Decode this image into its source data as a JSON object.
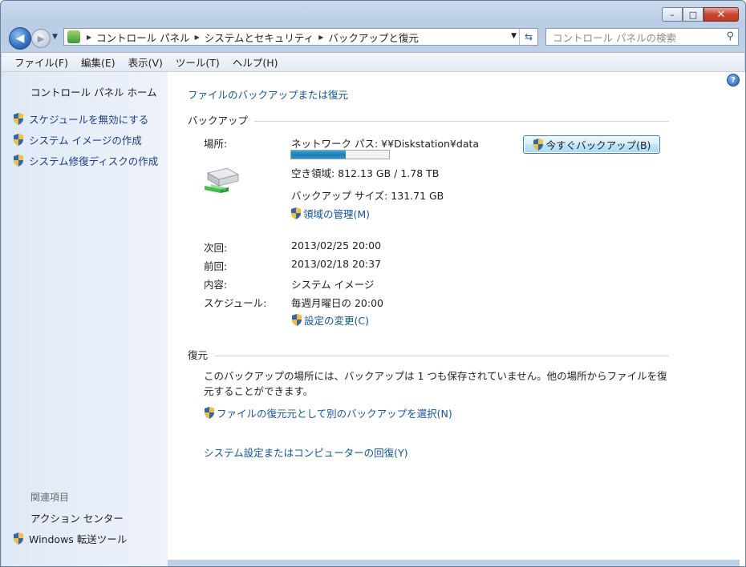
{
  "window": {
    "minimize": "–",
    "maximize": "□",
    "close": "✕"
  },
  "address": {
    "crumbs": [
      "コントロール パネル",
      "システムとセキュリティ",
      "バックアップと復元"
    ],
    "search_placeholder": "コントロール パネルの検索"
  },
  "menu": [
    "ファイル(F)",
    "編集(E)",
    "表示(V)",
    "ツール(T)",
    "ヘルプ(H)"
  ],
  "sidebar": {
    "home": "コントロール パネル ホーム",
    "links": [
      "スケジュールを無効にする",
      "システム イメージの作成",
      "システム修復ディスクの作成"
    ],
    "related_header": "関連項目",
    "related": [
      "アクション センター",
      "Windows 転送ツール"
    ]
  },
  "main": {
    "title": "ファイルのバックアップまたは復元",
    "backup": {
      "header": "バックアップ",
      "location_label": "場所:",
      "location_value": "ネットワーク パス: ¥¥Diskstation¥data",
      "free_space": "空き領域: 812.13 GB / 1.78 TB",
      "usage_fraction": 0.56,
      "backup_size": "バックアップ サイズ: 131.71 GB",
      "manage_space": "領域の管理(M)",
      "backup_now": "今すぐバックアップ(B)",
      "next_label": "次回:",
      "next_value": "2013/02/25 20:00",
      "last_label": "前回:",
      "last_value": "2013/02/18 20:37",
      "contents_label": "内容:",
      "contents_value": "システム イメージ",
      "schedule_label": "スケジュール:",
      "schedule_value": "毎週月曜日の 20:00",
      "change_settings": "設定の変更(C)"
    },
    "restore": {
      "header": "復元",
      "message": "このバックアップの場所には、バックアップは 1 つも保存されていません。他の場所からファイルを復元することができます。",
      "select_other": "ファイルの復元元として別のバックアップを選択(N)",
      "recover_system": "システム設定またはコンピューターの回復(Y)"
    }
  }
}
